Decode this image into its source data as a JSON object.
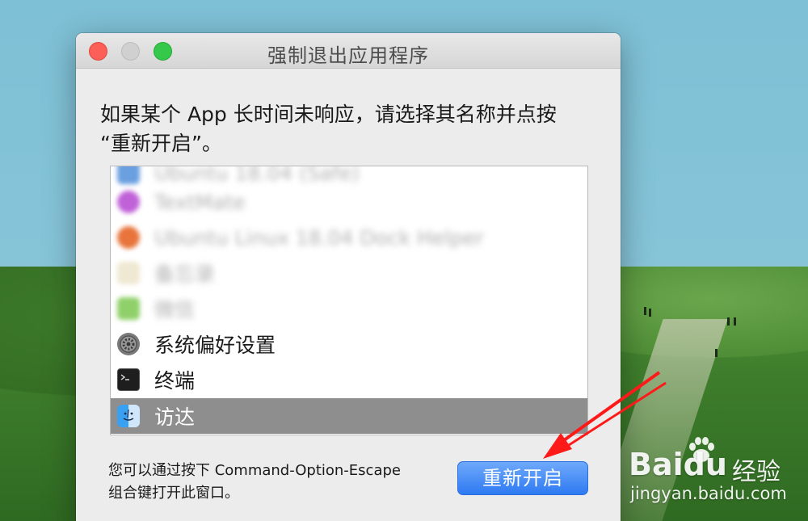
{
  "window": {
    "title": "强制退出应用程序",
    "prompt_line1": "如果某个 App 长时间未响应，请选择其名称并点按",
    "prompt_line2": "“重新开启”。"
  },
  "app_list": {
    "items": [
      {
        "label": "Ubuntu 18.04 (Safe)",
        "icon": "app-icon-blue",
        "blurred": true
      },
      {
        "label": "TextMate",
        "icon": "app-icon-purple",
        "blurred": true
      },
      {
        "label": "Ubuntu Linux 18.04 Dock Helper",
        "icon": "app-icon-orange",
        "blurred": true
      },
      {
        "label": "备忘录",
        "icon": "notes-icon",
        "blurred": true
      },
      {
        "label": "微信",
        "icon": "wechat-icon",
        "blurred": true
      },
      {
        "label": "系统偏好设置",
        "icon": "gear-icon",
        "blurred": false
      },
      {
        "label": "终端",
        "icon": "terminal-icon",
        "blurred": false
      },
      {
        "label": "访达",
        "icon": "finder-icon",
        "blurred": false,
        "selected": true
      }
    ]
  },
  "footer": {
    "hint_line1": "您可以通过按下 Command-Option-Escape",
    "hint_line2": "组合键打开此窗口。",
    "relaunch_label": "重新开启"
  },
  "watermark": {
    "brand": "Baidu",
    "sub": "经验",
    "url": "jingyan.baidu.com"
  },
  "colors": {
    "accent": "#2e7af2",
    "selection": "#8e8e8e",
    "annotation": "#ff1a1a"
  }
}
